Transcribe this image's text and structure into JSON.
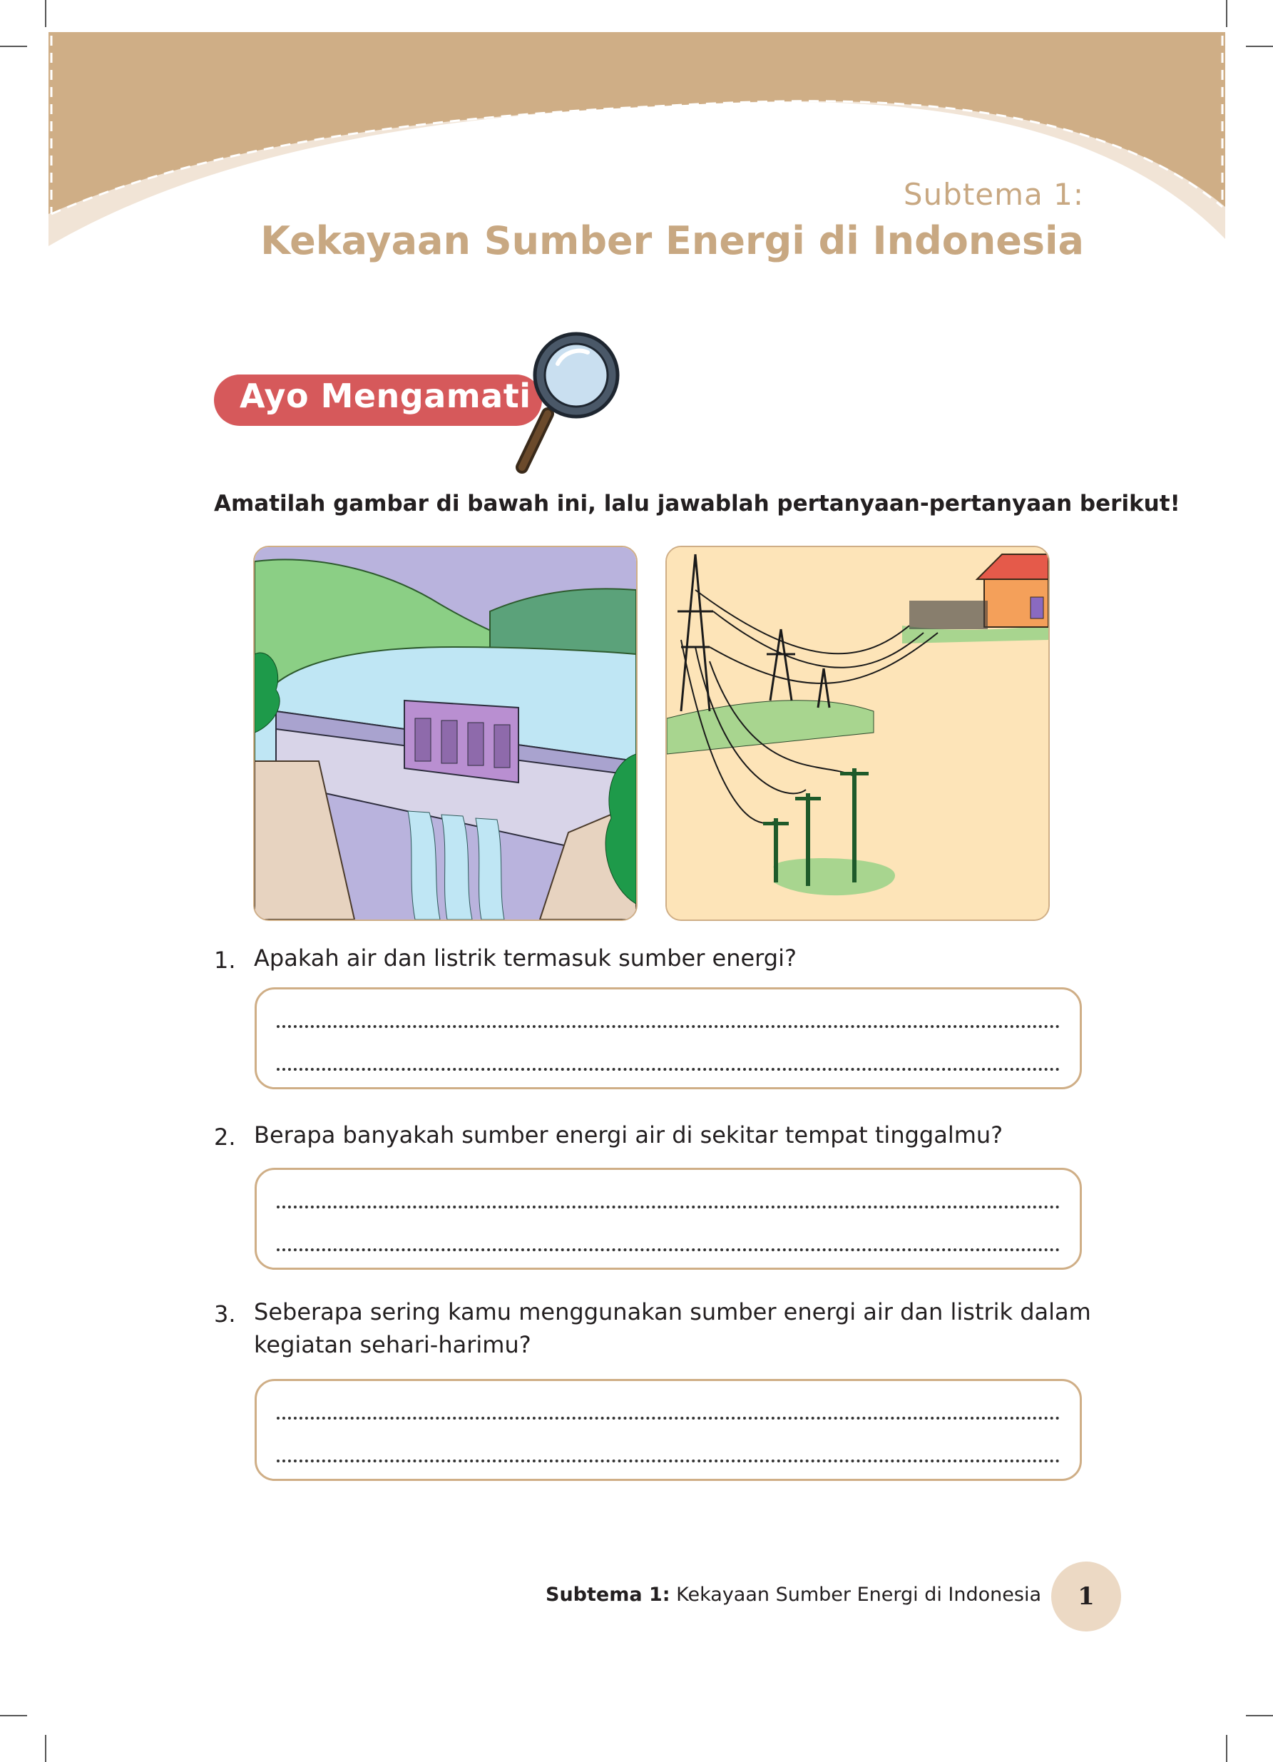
{
  "header": {
    "subtitle": "Subtema 1:",
    "title": "Kekayaan Sumber Energi di Indonesia",
    "band_color": "#cfae86",
    "band_light_color": "#f1e4d6"
  },
  "section": {
    "label": "Ayo Mengamati",
    "label_color": "#d6595b",
    "icon": "magnifying-glass-icon"
  },
  "instruction": "Amatilah gambar di bawah ini, lalu jawablah pertanyaan-pertanyaan berikut!",
  "illustrations": {
    "left": "hydroelectric-dam",
    "right": "power-transmission-lines"
  },
  "questions": [
    {
      "number": "1.",
      "text": "Apakah air dan listrik termasuk sumber energi?"
    },
    {
      "number": "2.",
      "text": "Berapa banyakah sumber energi air di sekitar tempat tinggalmu?"
    },
    {
      "number": "3.",
      "text_line1": "Seberapa sering kamu menggunakan sumber energi air dan listrik dalam",
      "text_line2": "kegiatan sehari-harimu?"
    }
  ],
  "footer": {
    "label_bold": "Subtema 1:",
    "label": " Kekayaan Sumber Energi di Indonesia",
    "page_number": "1"
  }
}
